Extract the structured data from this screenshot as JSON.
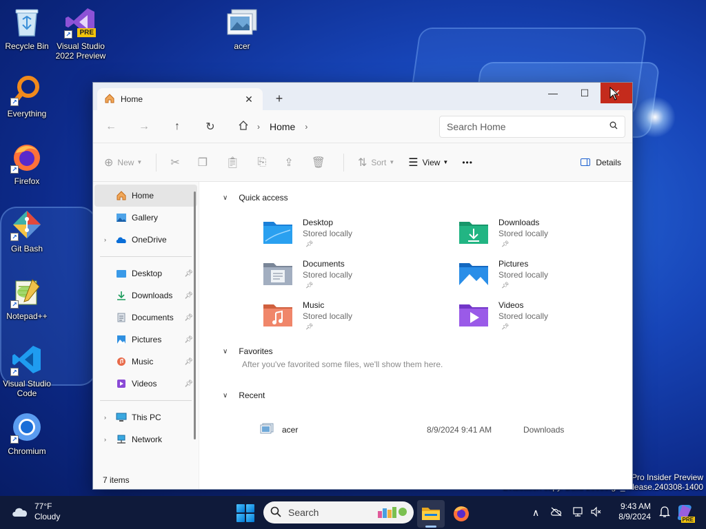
{
  "desktop": {
    "icons": [
      {
        "label": "Recycle Bin"
      },
      {
        "label": "Visual Studio 2022 Preview",
        "badge": "PRE"
      },
      {
        "label": "acer"
      },
      {
        "label": "Everything"
      },
      {
        "label": "Firefox"
      },
      {
        "label": "Git Bash"
      },
      {
        "label": "Notepad++"
      },
      {
        "label": "Visual Studio Code"
      },
      {
        "label": "Chromium"
      }
    ],
    "watermark": {
      "line1": "Pro Insider Preview",
      "line2": "Evaluation copy. Build 26080.ge_release.240308-1400"
    }
  },
  "explorer": {
    "tab": {
      "label": "Home",
      "close": "✕"
    },
    "new_tab": "+",
    "window_controls": {
      "minimize": "—",
      "maximize": "☐",
      "close": "✕"
    },
    "address": {
      "crumb": "Home"
    },
    "search": {
      "placeholder": "Search Home"
    },
    "commands": {
      "new": "New",
      "sort": "Sort",
      "view": "View",
      "more": "•••",
      "details": "Details"
    },
    "sidebar": {
      "top": [
        {
          "label": "Home"
        },
        {
          "label": "Gallery"
        },
        {
          "label": "OneDrive"
        }
      ],
      "pinned": [
        {
          "label": "Desktop"
        },
        {
          "label": "Downloads"
        },
        {
          "label": "Documents"
        },
        {
          "label": "Pictures"
        },
        {
          "label": "Music"
        },
        {
          "label": "Videos"
        }
      ],
      "devices": [
        {
          "label": "This PC"
        },
        {
          "label": "Network"
        }
      ]
    },
    "status": "7 items",
    "quick_access": {
      "heading": "Quick access",
      "items": [
        {
          "name": "Desktop",
          "sub": "Stored locally"
        },
        {
          "name": "Downloads",
          "sub": "Stored locally"
        },
        {
          "name": "Documents",
          "sub": "Stored locally"
        },
        {
          "name": "Pictures",
          "sub": "Stored locally"
        },
        {
          "name": "Music",
          "sub": "Stored locally"
        },
        {
          "name": "Videos",
          "sub": "Stored locally"
        }
      ]
    },
    "favorites": {
      "heading": "Favorites",
      "empty_note": "After you've favorited some files, we'll show them here."
    },
    "recent": {
      "heading": "Recent",
      "rows": [
        {
          "name": "acer",
          "date": "8/9/2024 9:41 AM",
          "location": "Downloads"
        }
      ]
    }
  },
  "taskbar": {
    "weather": {
      "temp": "77°F",
      "condition": "Cloudy"
    },
    "search_label": "Search",
    "clock": {
      "time": "9:43 AM",
      "date": "8/9/2024"
    },
    "copilot_badge": "PRE"
  },
  "colors": {
    "accent": "#0078d4",
    "close_red": "#c42b1c"
  }
}
